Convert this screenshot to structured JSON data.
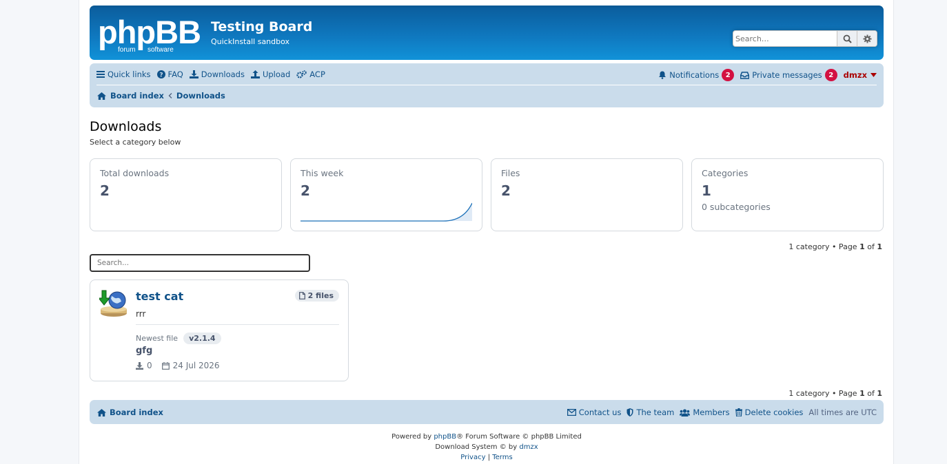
{
  "header": {
    "logo_text": "phpBB",
    "logo_sub": "forum software",
    "site_title": "Testing Board",
    "site_desc": "QuickInstall sandbox",
    "search_placeholder": "Search…"
  },
  "nav": {
    "quick_links": "Quick links",
    "faq": "FAQ",
    "downloads": "Downloads",
    "upload": "Upload",
    "acp": "ACP",
    "notifications": "Notifications",
    "notifications_count": "2",
    "private_messages": "Private messages",
    "pm_count": "2",
    "username": "dmzx"
  },
  "breadcrumbs": [
    "Board index",
    "Downloads"
  ],
  "page": {
    "title": "Downloads",
    "subtitle": "Select a category below"
  },
  "stats": [
    {
      "label": "Total downloads",
      "value": "2",
      "extra": ""
    },
    {
      "label": "This week",
      "value": "2",
      "extra": ""
    },
    {
      "label": "Files",
      "value": "2",
      "extra": ""
    },
    {
      "label": "Categories",
      "value": "1",
      "extra": "0 subcategories"
    }
  ],
  "sparkline": [
    0,
    0,
    0,
    0,
    0,
    0,
    2
  ],
  "pagination": {
    "count_text": "1 category • Page",
    "page": "1",
    "of_text": "of",
    "total": "1"
  },
  "category_search_placeholder": "Search...",
  "category": {
    "name": "test cat",
    "description": "rrr",
    "files_badge": "2 files",
    "newest_label": "Newest file",
    "newest_version": "v2.1.4",
    "newest_file": "gfg",
    "downloads": "0",
    "date": "24 Jul 2026"
  },
  "footer": {
    "board_index": "Board index",
    "contact": "Contact us",
    "team": "The team",
    "members": "Members",
    "delete_cookies": "Delete cookies",
    "timezone": "All times are UTC",
    "powered_prefix": "Powered by",
    "powered_link": "phpBB",
    "powered_suffix": "® Forum Software © phpBB Limited",
    "dl_prefix": "Download System © by",
    "dl_author": "dmzx",
    "privacy": "Privacy",
    "terms": "Terms"
  },
  "colors": {
    "header_blue": "#1192d8",
    "navbar_bg": "#cadceb",
    "link": "#105289",
    "badge_red": "#d31141",
    "user_red": "#aa0000"
  }
}
